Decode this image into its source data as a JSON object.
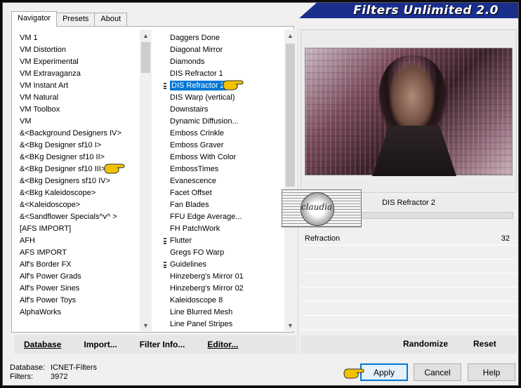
{
  "window": {
    "title": "Filters Unlimited 2.0"
  },
  "tabs": [
    {
      "label": "Navigator",
      "active": true
    },
    {
      "label": "Presets",
      "active": false
    },
    {
      "label": "About",
      "active": false
    }
  ],
  "categories": [
    "VM 1",
    "VM Distortion",
    "VM Experimental",
    "VM Extravaganza",
    "VM Instant Art",
    "VM Natural",
    "VM Toolbox",
    "VM",
    "&<Background Designers IV>",
    "&<Bkg Designer sf10 I>",
    "&<BKg Designer sf10 II>",
    "&<Bkg Designer sf10 III>",
    "&<Bkg Designers sf10 IV>",
    "&<Bkg Kaleidoscope>",
    "&<Kaleidoscope>",
    "&<Sandflower Specials^v^ >",
    "[AFS IMPORT]",
    "AFH",
    "AFS IMPORT",
    "Alf's Border FX",
    "Alf's Power Grads",
    "Alf's Power Sines",
    "Alf's Power Toys",
    "AlphaWorks"
  ],
  "categories_pointer_index": 10,
  "filters": [
    {
      "label": "Daggers Done",
      "marked": false
    },
    {
      "label": "Diagonal Mirror",
      "marked": false
    },
    {
      "label": "Diamonds",
      "marked": false
    },
    {
      "label": "DIS Refractor 1",
      "marked": false
    },
    {
      "label": "DIS Refractor 2",
      "marked": true,
      "selected": true
    },
    {
      "label": "DIS Warp (vertical)",
      "marked": false
    },
    {
      "label": "Downstairs",
      "marked": false
    },
    {
      "label": "Dynamic Diffusion...",
      "marked": false
    },
    {
      "label": "Emboss Crinkle",
      "marked": false
    },
    {
      "label": "Emboss Graver",
      "marked": false
    },
    {
      "label": "Emboss With Color",
      "marked": false
    },
    {
      "label": "EmbossTimes",
      "marked": false
    },
    {
      "label": "Evanescence",
      "marked": false
    },
    {
      "label": "Facet Offset",
      "marked": false
    },
    {
      "label": "Fan Blades",
      "marked": false
    },
    {
      "label": "FFU Edge Average...",
      "marked": false
    },
    {
      "label": "FH PatchWork",
      "marked": false
    },
    {
      "label": "Flutter",
      "marked": true
    },
    {
      "label": "Gregs FO Warp",
      "marked": false
    },
    {
      "label": "Guidelines",
      "marked": true
    },
    {
      "label": "Hinzeberg's Mirror 01",
      "marked": false
    },
    {
      "label": "Hinzeberg's Mirror 02",
      "marked": false
    },
    {
      "label": "Kaleidoscope 8",
      "marked": false
    },
    {
      "label": "Line Blurred Mesh",
      "marked": false
    },
    {
      "label": "Line Panel Stripes",
      "marked": false
    }
  ],
  "toolbar": {
    "database": "Database",
    "import": "Import...",
    "filter_info": "Filter Info...",
    "editor": "Editor...",
    "randomize": "Randomize",
    "reset": "Reset"
  },
  "preview": {
    "filter_name": "DIS Refractor 2",
    "logo_text": "claudia"
  },
  "parameters": [
    {
      "name": "Refraction",
      "value": "32"
    }
  ],
  "status": {
    "database_label": "Database:",
    "database_value": "ICNET-Filters",
    "filters_label": "Filters:",
    "filters_value": "3972"
  },
  "buttons": {
    "apply": "Apply",
    "cancel": "Cancel",
    "help": "Help"
  },
  "colors": {
    "banner": "#1a2f8c",
    "selection": "#0078d7",
    "pointer": "#f2c200"
  },
  "icons": [
    "pointing-hand-icon",
    "scroll-up-icon",
    "scroll-down-icon",
    "claudia-logo"
  ]
}
